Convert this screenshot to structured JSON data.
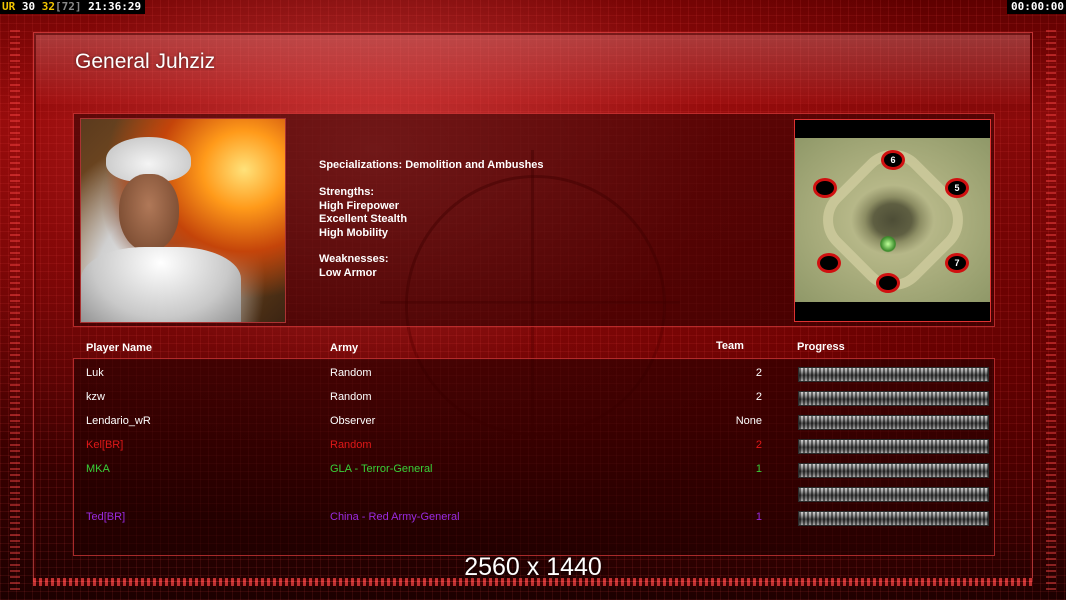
{
  "hud": {
    "left_prefix": "UR",
    "left_fps": "30",
    "left_fps_alt": "32",
    "left_fps_cap": "[72]",
    "clock": "21:36:29",
    "timer": "00:00:00"
  },
  "general": {
    "title": "General Juhziz",
    "specializations": "Specializations: Demolition and Ambushes",
    "strengths_label": "Strengths:",
    "strengths": [
      "High Firepower",
      "Excellent Stealth",
      "High Mobility"
    ],
    "weaknesses_label": "Weaknesses:",
    "weaknesses": [
      "Low Armor"
    ]
  },
  "minimap": {
    "spawn_labels": [
      "6",
      "",
      "5",
      "",
      "7",
      ""
    ]
  },
  "players": {
    "headers": {
      "name": "Player Name",
      "army": "Army",
      "team": "Team",
      "progress": "Progress"
    },
    "rows": [
      {
        "name": "Luk",
        "army": "Random",
        "team": "2",
        "color": "#ffffff"
      },
      {
        "name": "kzw",
        "army": "Random",
        "team": "2",
        "color": "#ffffff"
      },
      {
        "name": "Lendario_wR",
        "army": "Observer",
        "team": "None",
        "color": "#ffffff"
      },
      {
        "name": "Kel[BR]",
        "army": "Random",
        "team": "2",
        "color": "#e01818"
      },
      {
        "name": "MKA",
        "army": "GLA - Terror-General",
        "team": "1",
        "color": "#38d038"
      },
      {
        "name": "",
        "army": "",
        "team": "",
        "color": "#1a0a3a"
      },
      {
        "name": "Ted[BR]",
        "army": "China - Red Army-General",
        "team": "1",
        "color": "#9a2ae0"
      }
    ]
  },
  "overlay": {
    "resolution": "2560 x 1440"
  }
}
